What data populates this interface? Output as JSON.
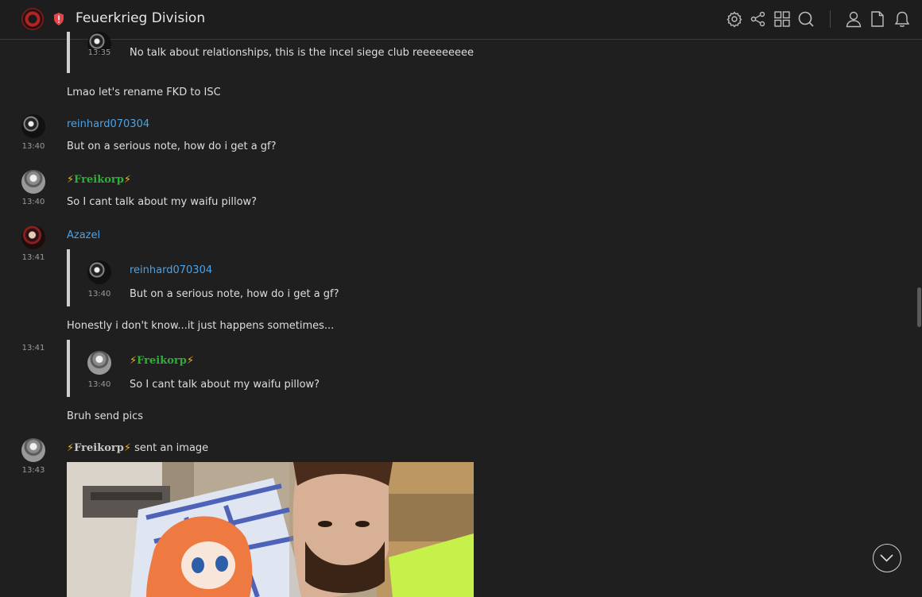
{
  "room": {
    "title": "Feuerkrieg Division"
  },
  "icons": {
    "room_avatar": "room-avatar",
    "shield": "shield-alert-icon",
    "toolbar": [
      "settings-icon",
      "share-icon",
      "apps-grid-icon",
      "search-icon",
      "member-icon",
      "files-icon",
      "notifications-icon"
    ],
    "scroll_down": "chevron-down-icon"
  },
  "colors": {
    "background": "#1f1f1f",
    "link_name": "#4aa3e8",
    "freikorp_name": "#2fae3a",
    "bolt": "#f2b51c"
  },
  "messages": {
    "m0_quote": {
      "time": "13:35",
      "text": "No talk about relationships, this is the incel siege club reeeeeeeee"
    },
    "m0_text": "Lmao let's rename FKD to ISC",
    "m1": {
      "sender": "reinhard070304",
      "time": "13:40",
      "text": "But on a serious note, how do i get a gf?"
    },
    "m2": {
      "sender_bolt_left": "⚡",
      "sender": "Freikorp",
      "sender_bolt_right": "⚡",
      "time": "13:40",
      "text": "So I cant talk about my waifu pillow?"
    },
    "m3": {
      "sender": "Azazel",
      "time": "13:41",
      "quote": {
        "sender": "reinhard070304",
        "time": "13:40",
        "text": "But on a serious note, how do i get a gf?"
      },
      "text": "Honestly i don't know...it just happens sometimes..."
    },
    "m4": {
      "time": "13:41",
      "quote": {
        "sender_bolt_left": "⚡",
        "sender": "Freikorp",
        "sender_bolt_right": "⚡",
        "time": "13:40",
        "text": "So I cant talk about my waifu pillow?"
      },
      "text": "Bruh send pics"
    },
    "m5": {
      "bolt_left": "⚡",
      "sender": "Freikorp",
      "bolt_right": "⚡",
      "action": "sent an image",
      "time": "13:43"
    }
  }
}
